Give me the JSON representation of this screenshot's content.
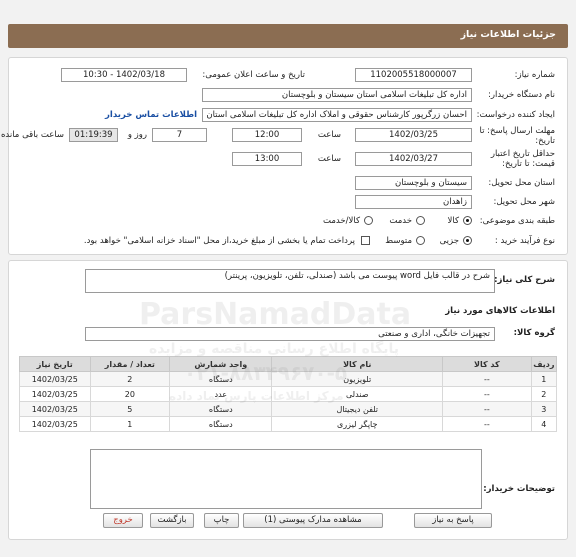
{
  "page_title": "جزئیات اطلاعات نیاز",
  "fields": {
    "need_number_label": "شماره نیاز:",
    "need_number": "1102005518000007",
    "announce_label": "تاریخ و ساعت اعلان عمومی:",
    "announce_value": "1402/03/18 - 10:30",
    "buyer_org_label": "نام دستگاه خریدار:",
    "buyer_org": "اداره کل تبلیغات اسلامی استان سیستان و بلوچستان",
    "creator_label": "ایجاد کننده درخواست:",
    "creator": "احسان زرگرپور کارشناس حقوقی و املاک اداره کل تبلیغات اسلامی استان سیستان",
    "buyer_contact_link": "اطلاعات تماس خریدار",
    "deadline_label": "مهلت ارسال پاسخ: تا تاریخ:",
    "deadline_date": "1402/03/25",
    "time_label": "ساعت",
    "deadline_time": "12:00",
    "days_value": "7",
    "days_label": "روز و",
    "remaining_value": "01:19:39",
    "remaining_label": "ساعت باقی مانده",
    "validity_label": "حداقل تاریخ اعتبار قیمت: تا تاریخ:",
    "validity_date": "1402/03/27",
    "validity_time_label": "ساعت",
    "validity_time": "13:00",
    "province_label": "استان محل تحویل:",
    "province": "سیستان و بلوچستان",
    "city_label": "شهر محل تحویل:",
    "city": "زاهدان",
    "category_label": "طبقه بندی موضوعی:",
    "category_options": [
      "کالا",
      "خدمت",
      "کالا/خدمت"
    ],
    "purchase_label": "نوع فرآیند خرید :",
    "purchase_options": [
      "جزیی",
      "متوسط"
    ],
    "payment_note": "پرداخت تمام یا بخشی از مبلغ خرید،از محل \"اسناد خزانه اسلامی\" خواهد بود."
  },
  "description": {
    "label": "شرح کلی نیاز:",
    "value": "شرح در قالب فایل word پیوست می باشد (صندلی، تلفن، تلویزیون، پرینتر)"
  },
  "goods": {
    "section_title": "اطلاعات کالاهای مورد نیاز",
    "group_label": "گروه کالا:",
    "group_value": "تجهیزات خانگی، اداری و صنعتی",
    "columns": [
      "ردیف",
      "کد کالا",
      "نام کالا",
      "واحد شمارش",
      "تعداد / مقدار",
      "تاریخ نیاز"
    ],
    "rows": [
      {
        "row": "1",
        "code": "--",
        "name": "تلویزیون",
        "unit": "دستگاه",
        "qty": "2",
        "date": "1402/03/25"
      },
      {
        "row": "2",
        "code": "--",
        "name": "صندلی",
        "unit": "عدد",
        "qty": "20",
        "date": "1402/03/25"
      },
      {
        "row": "3",
        "code": "--",
        "name": "تلفن دیجیتال",
        "unit": "دستگاه",
        "qty": "5",
        "date": "1402/03/25"
      },
      {
        "row": "4",
        "code": "--",
        "name": "چاپگر لیزری",
        "unit": "دستگاه",
        "qty": "1",
        "date": "1402/03/25"
      }
    ]
  },
  "buyer_notes": {
    "label": "توضیحات خریدار:",
    "value": ""
  },
  "buttons": {
    "reply": "پاسخ به نیاز",
    "attachments": "مشاهده مدارک پیوستی (1)",
    "print": "چاپ",
    "back": "بازگشت",
    "exit": "خروج"
  },
  "watermark": {
    "brand": "ParsNamadData",
    "lines": [
      "پایگاه اطلاع رسانی مناقصه و مزایده",
      "۰۲۱-۸۸۳۴۹۶۷۰-۵",
      "مرکز اطلاعات پارس نماد داده"
    ]
  },
  "colors": {
    "title_bar": "#8b6d52",
    "link": "#1a4fa3",
    "exit_text": "#c0392b"
  }
}
